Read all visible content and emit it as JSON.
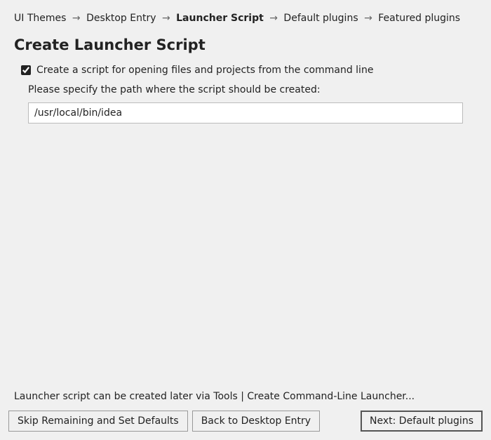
{
  "breadcrumb": {
    "items": [
      {
        "label": "UI Themes",
        "current": false
      },
      {
        "label": "Desktop Entry",
        "current": false
      },
      {
        "label": "Launcher Script",
        "current": true
      },
      {
        "label": "Default plugins",
        "current": false
      },
      {
        "label": "Featured plugins",
        "current": false
      }
    ],
    "separator": "→"
  },
  "title": "Create Launcher Script",
  "form": {
    "checkbox_label": "Create a script for opening files and projects from the command line",
    "checkbox_checked": true,
    "path_label": "Please specify the path where the script should be created:",
    "path_value": "/usr/local/bin/idea"
  },
  "hint": "Launcher script can be created later via Tools | Create Command-Line Launcher...",
  "buttons": {
    "skip": "Skip Remaining and Set Defaults",
    "back": "Back to Desktop Entry",
    "next": "Next: Default plugins"
  }
}
